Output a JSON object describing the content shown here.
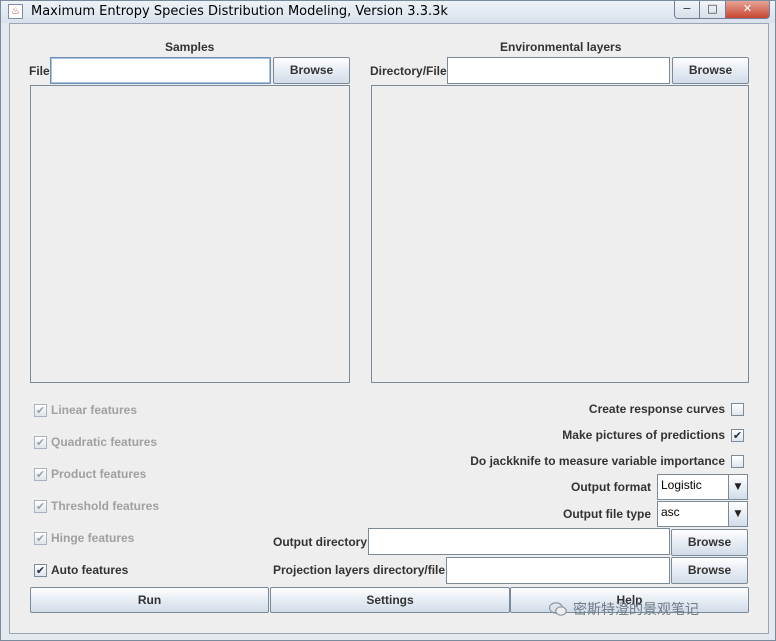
{
  "window": {
    "title": "Maximum Entropy Species Distribution Modeling, Version 3.3.3k",
    "controls": {
      "minimize": "−",
      "maximize": "□",
      "close": "✕"
    }
  },
  "samples": {
    "heading": "Samples",
    "file_label": "File",
    "file_value": "",
    "browse_label": "Browse"
  },
  "env_layers": {
    "heading": "Environmental layers",
    "dir_label": "Directory/File",
    "dir_value": "",
    "browse_label": "Browse"
  },
  "features": [
    {
      "label": "Linear features",
      "checked": true,
      "enabled": false
    },
    {
      "label": "Quadratic features",
      "checked": true,
      "enabled": false
    },
    {
      "label": "Product features",
      "checked": true,
      "enabled": false
    },
    {
      "label": "Threshold features",
      "checked": true,
      "enabled": false
    },
    {
      "label": "Hinge features",
      "checked": true,
      "enabled": false
    },
    {
      "label": "Auto features",
      "checked": true,
      "enabled": true
    }
  ],
  "options": {
    "response_curves": {
      "label": "Create response curves",
      "checked": false
    },
    "pictures": {
      "label": "Make pictures of predictions",
      "checked": true
    },
    "jackknife": {
      "label": "Do jackknife to measure variable importance",
      "checked": false
    },
    "output_format": {
      "label": "Output format",
      "value": "Logistic"
    },
    "output_file_type": {
      "label": "Output file type",
      "value": "asc"
    }
  },
  "output": {
    "dir_label": "Output directory",
    "dir_value": "",
    "browse_label": "Browse",
    "proj_label": "Projection layers directory/file",
    "proj_value": "",
    "proj_browse_label": "Browse"
  },
  "actions": {
    "run": "Run",
    "settings": "Settings",
    "help": "Help"
  },
  "watermark": "密斯特澄的景观笔记",
  "check_glyph": "✔"
}
